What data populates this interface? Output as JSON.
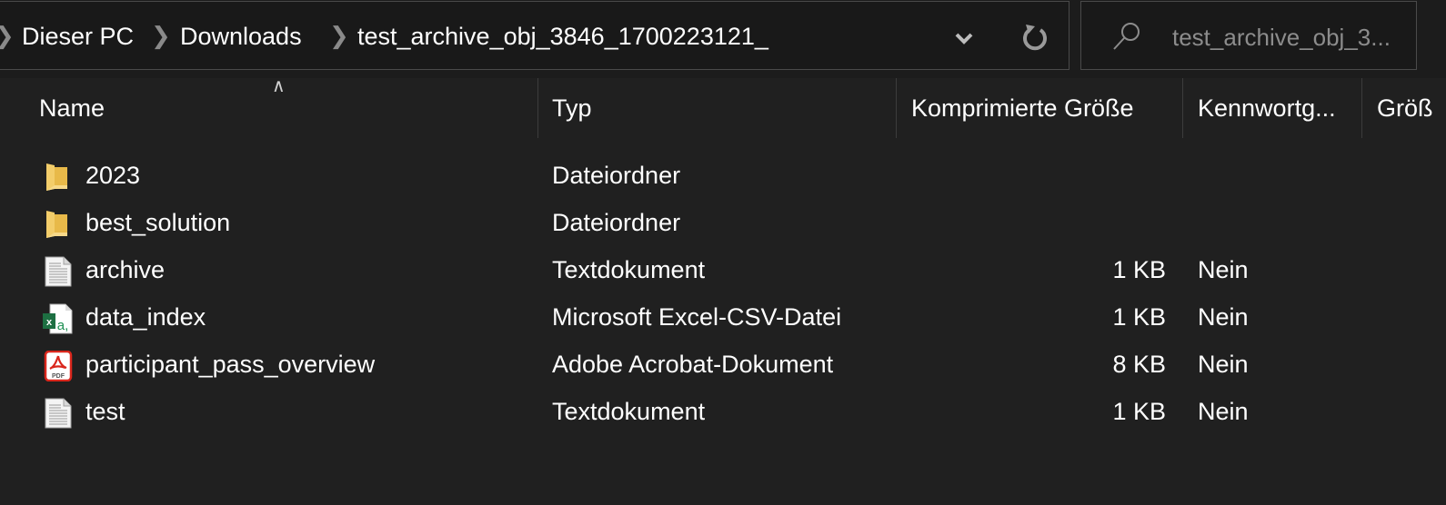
{
  "address_bar": {
    "breadcrumbs": [
      "Dieser PC",
      "Downloads",
      "test_archive_obj_3846_1700223121_"
    ],
    "dropdown_icon": "chevron-down-icon",
    "refresh_icon": "refresh-icon"
  },
  "search": {
    "icon": "search-icon",
    "placeholder": "test_archive_obj_3..."
  },
  "columns": [
    {
      "label": "Name",
      "sorted": "ascending"
    },
    {
      "label": "Typ"
    },
    {
      "label": "Komprimierte Größe"
    },
    {
      "label": "Kennwortg..."
    },
    {
      "label": "Größ"
    }
  ],
  "files": [
    {
      "name": "2023",
      "type": "Dateiordner",
      "compressed_size": "",
      "password": "",
      "icon": "folder-icon"
    },
    {
      "name": "best_solution",
      "type": "Dateiordner",
      "compressed_size": "",
      "password": "",
      "icon": "folder-icon"
    },
    {
      "name": "archive",
      "type": "Textdokument",
      "compressed_size": "1 KB",
      "password": "Nein",
      "icon": "text-file-icon"
    },
    {
      "name": "data_index",
      "type": "Microsoft Excel-CSV-Datei",
      "compressed_size": "1 KB",
      "password": "Nein",
      "icon": "excel-csv-icon"
    },
    {
      "name": "participant_pass_overview",
      "type": "Adobe Acrobat-Dokument",
      "compressed_size": "8 KB",
      "password": "Nein",
      "icon": "pdf-icon"
    },
    {
      "name": "test",
      "type": "Textdokument",
      "compressed_size": "1 KB",
      "password": "Nein",
      "icon": "text-file-icon"
    }
  ],
  "colors": {
    "background": "#202020",
    "toolbar": "#191919",
    "text": "#ffffff",
    "muted": "#8c8c8c",
    "folder": "#f3cd6a",
    "excel_green": "#1d6f42",
    "pdf_red": "#d9261c"
  }
}
